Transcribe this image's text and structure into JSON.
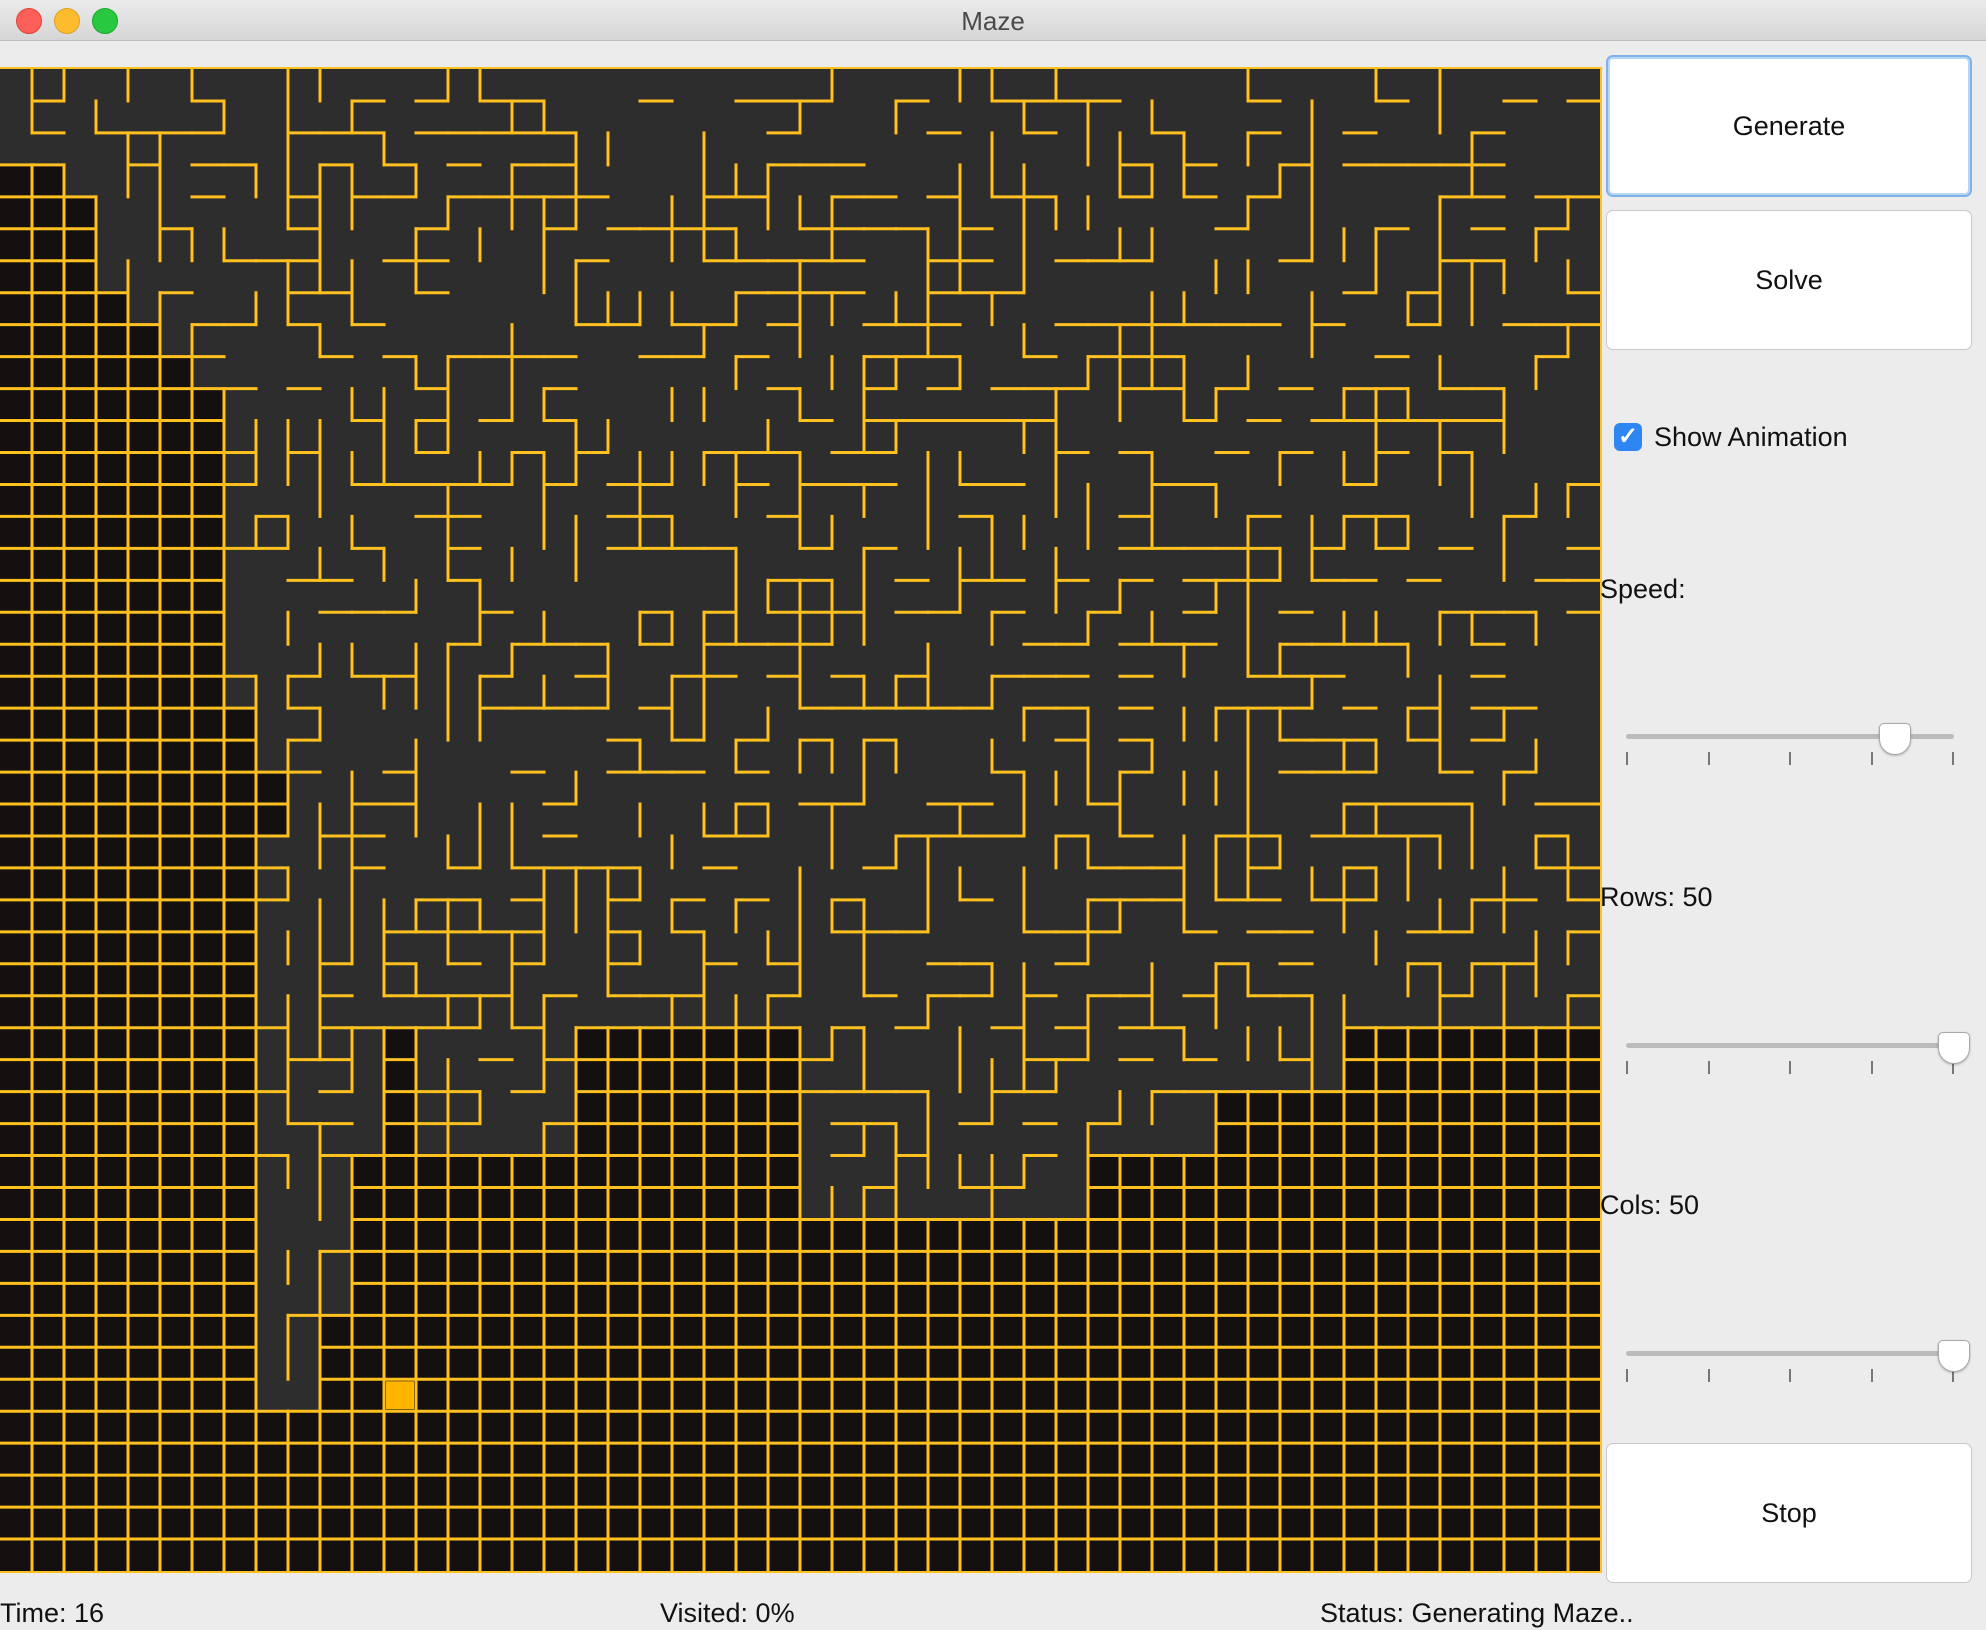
{
  "window": {
    "title": "Maze"
  },
  "buttons": {
    "generate": "Generate",
    "solve": "Solve",
    "stop": "Stop"
  },
  "checkbox": {
    "label": "Show Animation",
    "checked": true
  },
  "speed": {
    "label": "Speed:",
    "value": 0.82,
    "ticks": 5
  },
  "rows": {
    "label": "Rows: 50",
    "value": 50,
    "max_fraction": 1.0,
    "ticks": 5
  },
  "cols": {
    "label": "Cols: 50",
    "value": 50,
    "max_fraction": 1.0,
    "ticks": 5
  },
  "statusbar": {
    "time": "Time: 16",
    "visited": "Visited: 0%",
    "status": "Status: Generating Maze.."
  },
  "colors": {
    "wall": "#ffc020",
    "corridor": "#2d2d2d",
    "unvisited": "#141010",
    "current_cell": "#ffb400"
  },
  "maze": {
    "grid_cols": 50,
    "grid_rows": 47,
    "current_cell": [
      12,
      41
    ]
  }
}
